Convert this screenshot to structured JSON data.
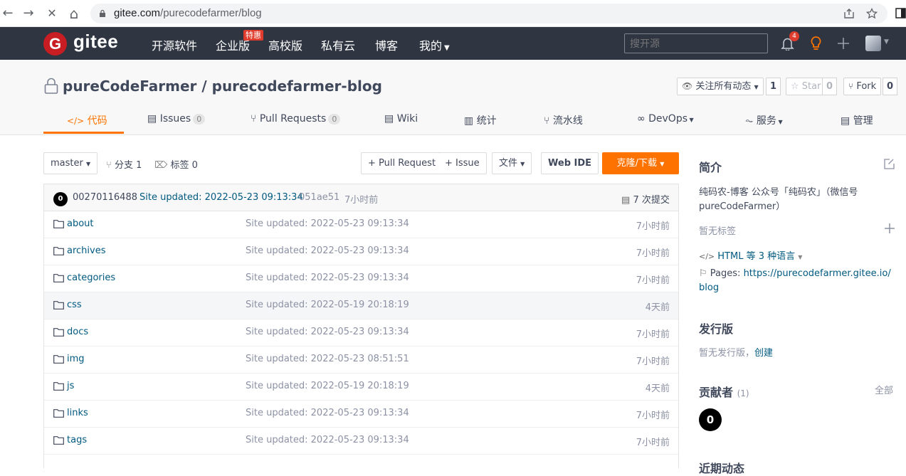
{
  "browser": {
    "back_icon": "←",
    "forward_icon": "→",
    "stop_icon": "✕",
    "home_icon": "⌂",
    "url_host": "gitee.com",
    "url_path": "/purecodefarmer/blog"
  },
  "topnav": {
    "logo_text": "gitee",
    "items": [
      "开源软件",
      "企业版",
      "高校版",
      "私有云",
      "博客",
      "我的"
    ],
    "promo_badge": "特惠",
    "search_placeholder": "搜开源",
    "notification_count": "4"
  },
  "repo": {
    "title": "pureCodeFarmer / purecodefarmer-blog",
    "watch_label": "关注所有动态",
    "watch_count": "1",
    "star_label": "Star",
    "star_count": "0",
    "fork_label": "Fork",
    "fork_count": "0",
    "tabs": [
      {
        "label": "代码",
        "count": null
      },
      {
        "label": "Issues",
        "count": "0"
      },
      {
        "label": "Pull Requests",
        "count": "0"
      },
      {
        "label": "Wiki",
        "count": null
      },
      {
        "label": "统计",
        "count": null
      },
      {
        "label": "流水线",
        "count": null
      },
      {
        "label": "DevOps",
        "count": null
      },
      {
        "label": "服务",
        "count": null
      },
      {
        "label": "管理",
        "count": null
      }
    ]
  },
  "toolbar": {
    "branch": "master",
    "branches": "分支 1",
    "tags": "标签 0",
    "pull_request": "+ Pull Request",
    "issue": "+ Issue",
    "file": "文件",
    "web_ide": "Web IDE",
    "clone": "克隆/下载"
  },
  "commit": {
    "avatar": "0",
    "author": "00270116488",
    "message": "Site updated: 2022-05-23 09:13:34",
    "hash": "051ae51",
    "time": "7小时前",
    "commits": "7 次提交"
  },
  "files": [
    {
      "name": "about",
      "message": "Site updated: 2022-05-23 09:13:34",
      "time": "7小时前"
    },
    {
      "name": "archives",
      "message": "Site updated: 2022-05-23 09:13:34",
      "time": "7小时前"
    },
    {
      "name": "categories",
      "message": "Site updated: 2022-05-23 09:13:34",
      "time": "7小时前"
    },
    {
      "name": "css",
      "message": "Site updated: 2022-05-19 20:18:19",
      "time": "4天前"
    },
    {
      "name": "docs",
      "message": "Site updated: 2022-05-23 09:13:34",
      "time": "7小时前"
    },
    {
      "name": "img",
      "message": "Site updated: 2022-05-23 08:51:51",
      "time": "7小时前"
    },
    {
      "name": "js",
      "message": "Site updated: 2022-05-19 20:18:19",
      "time": "4天前"
    },
    {
      "name": "links",
      "message": "Site updated: 2022-05-23 09:13:34",
      "time": "7小时前"
    },
    {
      "name": "tags",
      "message": "Site updated: 2022-05-23 09:13:34",
      "time": "7小时前"
    }
  ],
  "sidebar": {
    "intro_title": "简介",
    "intro_line1": "纯码农-博客 公众号「纯码农」（微信号",
    "intro_line2": "pureCodeFarmer）",
    "no_tags": "暂无标签",
    "language": "HTML 等 3 种语言",
    "pages_label": "Pages:",
    "pages_url1": "https://purecodefarmer.gitee.io/",
    "pages_url2": "blog",
    "release_title": "发行版",
    "no_release": "暂无发行版，",
    "create": "创建",
    "contrib_title": "贡献者",
    "contrib_count": "(1)",
    "all": "全部",
    "contrib_avatar": "0",
    "recent_title": "近期动态"
  }
}
